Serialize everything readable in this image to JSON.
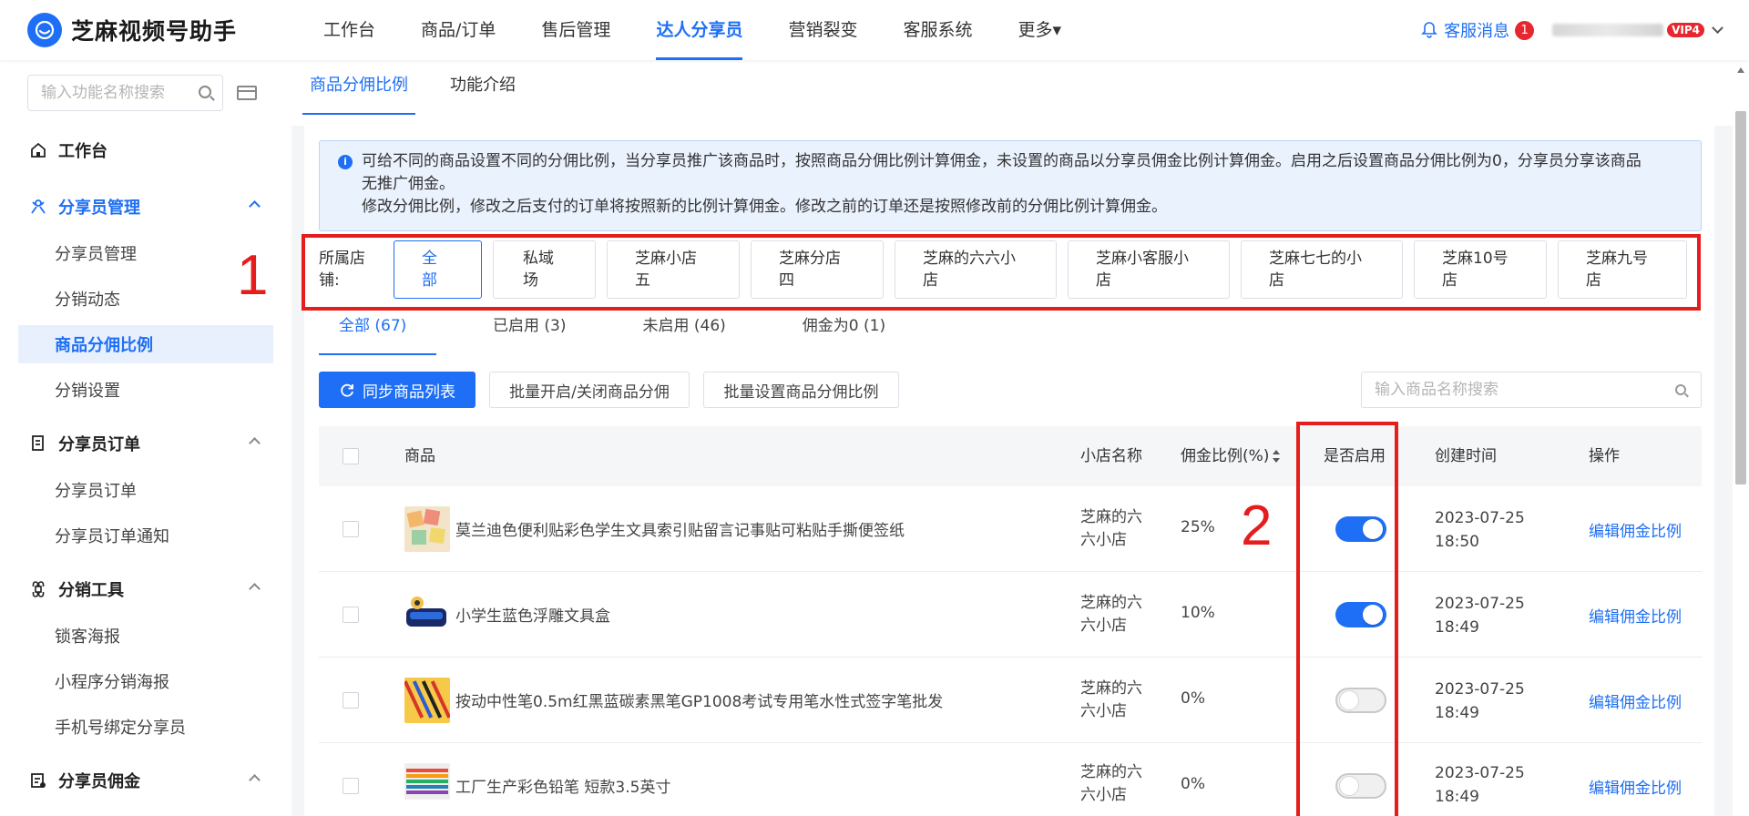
{
  "app": {
    "title": "芝麻视频号助手"
  },
  "nav": {
    "items": [
      {
        "label": "工作台",
        "active": false
      },
      {
        "label": "商品/订单",
        "active": false
      },
      {
        "label": "售后管理",
        "active": false
      },
      {
        "label": "达人分享员",
        "active": true
      },
      {
        "label": "营销裂变",
        "active": false
      },
      {
        "label": "客服系统",
        "active": false
      },
      {
        "label": "更多▾",
        "active": false
      }
    ],
    "message_label": "客服消息",
    "message_count": "1",
    "vip_label": "VIP4"
  },
  "sidebar": {
    "search_placeholder": "输入功能名称搜索",
    "items": [
      {
        "label": "工作台",
        "type": "top"
      },
      {
        "label": "分享员管理",
        "type": "top",
        "open": true
      },
      {
        "label": "分享员管理",
        "type": "sub"
      },
      {
        "label": "分销动态",
        "type": "sub"
      },
      {
        "label": "商品分佣比例",
        "type": "sub",
        "active": true
      },
      {
        "label": "分销设置",
        "type": "sub"
      },
      {
        "label": "分享员订单",
        "type": "top"
      },
      {
        "label": "分享员订单",
        "type": "sub"
      },
      {
        "label": "分享员订单通知",
        "type": "sub"
      },
      {
        "label": "分销工具",
        "type": "top"
      },
      {
        "label": "锁客海报",
        "type": "sub"
      },
      {
        "label": "小程序分销海报",
        "type": "sub"
      },
      {
        "label": "手机号绑定分享员",
        "type": "sub"
      },
      {
        "label": "分享员佣金",
        "type": "top"
      }
    ]
  },
  "page": {
    "tabs": [
      {
        "label": "商品分佣比例",
        "active": true
      },
      {
        "label": "功能介绍",
        "active": false
      }
    ],
    "notice": {
      "line1": "可给不同的商品设置不同的分佣比例，当分享员推广该商品时，按照商品分佣比例计算佣金，未设置的商品以分享员佣金比例计算佣金。启用之后设置商品分佣比例为0，分享员分享该商品",
      "line2": "无推广佣金。",
      "line3": "修改分佣比例，修改之后支付的订单将按照新的比例计算佣金。修改之前的订单还是按照修改前的分佣比例计算佣金。"
    },
    "store_filter": {
      "label_line1": "所属店",
      "label_line2": "铺:",
      "options": [
        {
          "l1": "全",
          "l2": "部",
          "active": true
        },
        {
          "l1": "私域",
          "l2": "场"
        },
        {
          "l1": "芝麻小店",
          "l2": "五"
        },
        {
          "l1": "芝麻分店",
          "l2": "四"
        },
        {
          "l1": "芝麻的六六小",
          "l2": "店"
        },
        {
          "l1": "芝麻小客服小",
          "l2": "店"
        },
        {
          "l1": "芝麻七七的小",
          "l2": "店"
        },
        {
          "l1": "芝麻10号",
          "l2": "店"
        },
        {
          "l1": "芝麻九号",
          "l2": "店"
        }
      ]
    },
    "filter_tabs": [
      {
        "label": "全部 (67)",
        "active": true
      },
      {
        "label": "已启用 (3)"
      },
      {
        "label": "未启用 (46)"
      },
      {
        "label": "佣金为0 (1)"
      }
    ],
    "actions": {
      "sync": "同步商品列表",
      "batch_toggle": "批量开启/关闭商品分佣",
      "batch_ratio": "批量设置商品分佣比例",
      "search_placeholder": "输入商品名称搜索"
    },
    "table": {
      "headers": {
        "product": "商品",
        "shop": "小店名称",
        "ratio": "佣金比例(%)",
        "enabled": "是否启用",
        "created": "创建时间",
        "ops": "操作"
      },
      "rows": [
        {
          "name": "莫兰迪色便利贴彩色学生文具索引贴留言记事贴可粘贴手撕便签纸",
          "shop_l1": "芝麻的六",
          "shop_l2": "六小店",
          "ratio": "25%",
          "enabled": true,
          "date": "2023-07-25",
          "time": "18:50",
          "op": "编辑佣金比例"
        },
        {
          "name": "小学生蓝色浮雕文具盒",
          "shop_l1": "芝麻的六",
          "shop_l2": "六小店",
          "ratio": "10%",
          "enabled": true,
          "date": "2023-07-25",
          "time": "18:49",
          "op": "编辑佣金比例"
        },
        {
          "name": "按动中性笔0.5m红黑蓝碳素黑笔GP1008考试专用笔水性式签字笔批发",
          "shop_l1": "芝麻的六",
          "shop_l2": "六小店",
          "ratio": "0%",
          "enabled": false,
          "date": "2023-07-25",
          "time": "18:49",
          "op": "编辑佣金比例"
        },
        {
          "name": "工厂生产彩色铅笔 短款3.5英寸",
          "shop_l1": "芝麻的六",
          "shop_l2": "六小店",
          "ratio": "0%",
          "enabled": false,
          "date": "2023-07-25",
          "time": "18:49",
          "op": "编辑佣金比例"
        }
      ]
    }
  },
  "annotations": {
    "label1": "1",
    "label2": "2"
  },
  "colors": {
    "accent": "#1e6ff5",
    "annotation": "#e51d1d",
    "badge": "#e7262f"
  }
}
